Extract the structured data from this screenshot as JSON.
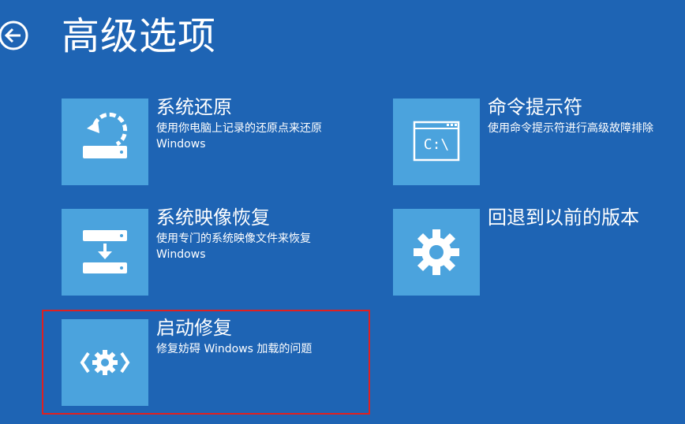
{
  "header": {
    "title": "高级选项",
    "back_icon": "back-arrow-icon"
  },
  "options": [
    {
      "title": "系统还原",
      "description_line1": "使用你电脑上记录的还原点来还原",
      "description_line2": "Windows",
      "icon": "system-restore-icon"
    },
    {
      "title": "命令提示符",
      "description_line1": "使用命令提示符进行高级故障排除",
      "description_line2": "",
      "icon_text": "C:\\",
      "icon": "command-prompt-icon"
    },
    {
      "title": "系统映像恢复",
      "description_line1": "使用专门的系统映像文件来恢复",
      "description_line2": "Windows",
      "icon": "system-image-recovery-icon"
    },
    {
      "title": "回退到以前的版本",
      "description_line1": "",
      "description_line2": "",
      "icon": "gear-icon"
    },
    {
      "title": "启动修复",
      "description_line1": "修复妨碍 Windows 加载的问题",
      "description_line2": "",
      "icon": "startup-repair-icon"
    }
  ],
  "colors": {
    "background": "#1e64b4",
    "tile": "#4ba3dd",
    "highlight": "#e02020",
    "text": "#ffffff"
  }
}
